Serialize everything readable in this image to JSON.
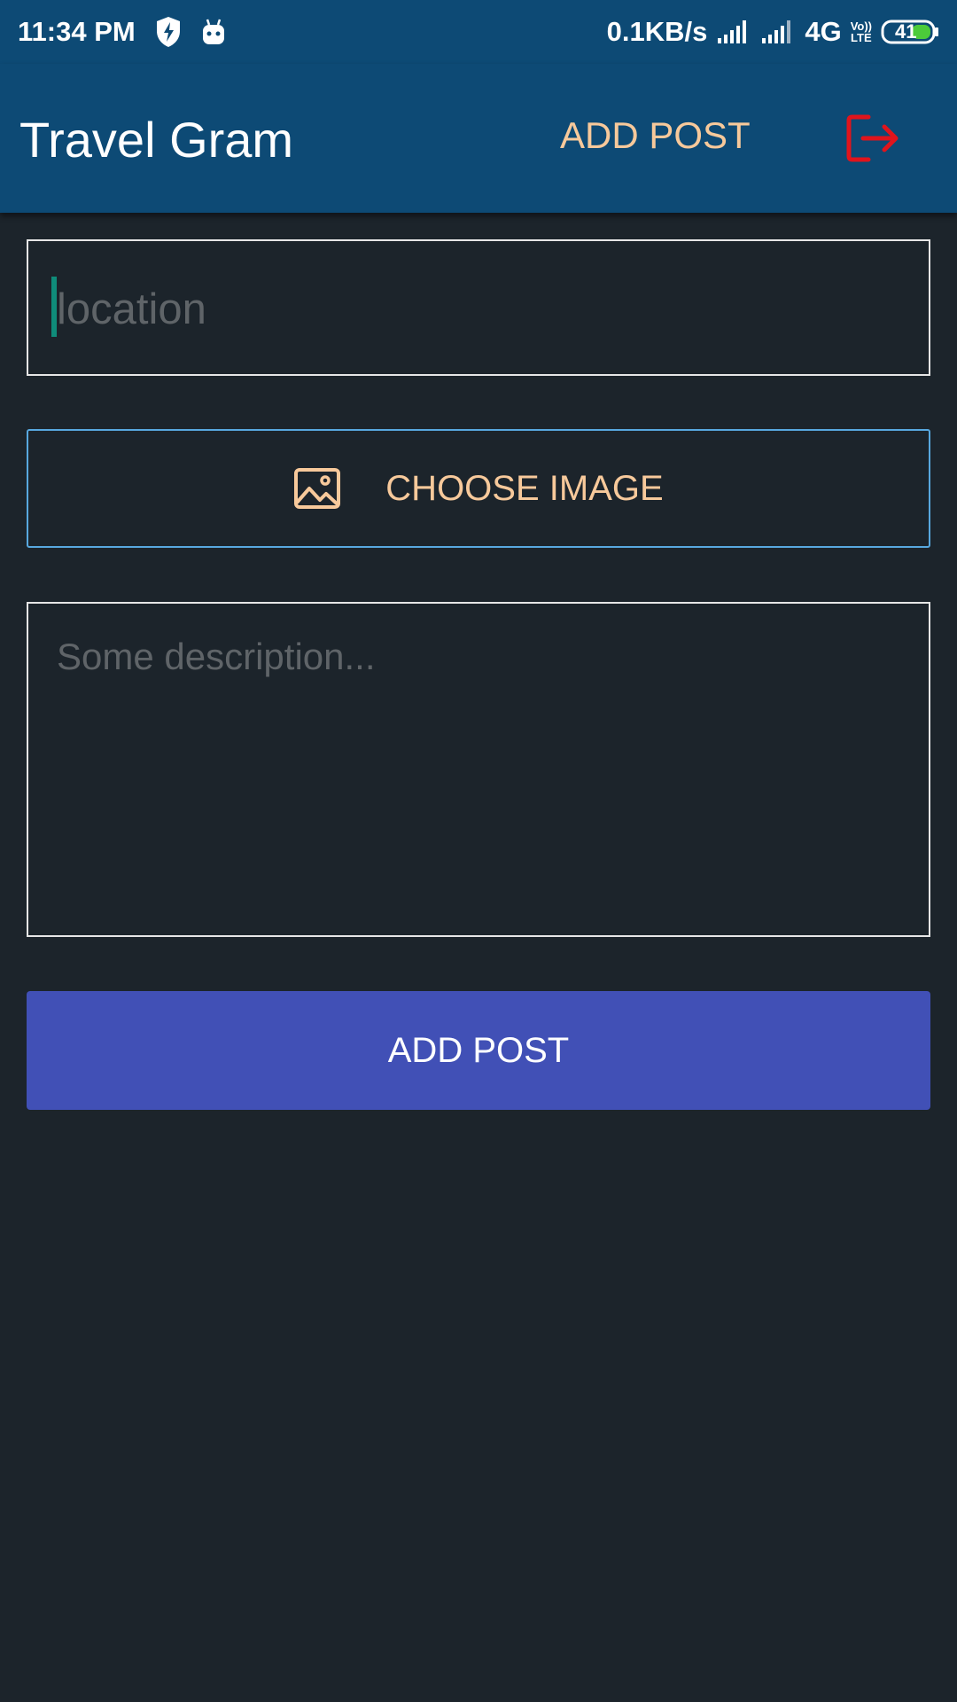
{
  "status_bar": {
    "time": "11:34 PM",
    "network_speed": "0.1KB/s",
    "network_type": "4G",
    "volte_top": "Vo))",
    "volte_bottom": "LTE",
    "battery": "41"
  },
  "app_bar": {
    "title": "Travel Gram",
    "add_post_label": "ADD POST",
    "logout_icon": "logout-icon"
  },
  "form": {
    "location_placeholder": "location",
    "location_value": "",
    "choose_image_label": "CHOOSE IMAGE",
    "choose_image_icon": "image-icon",
    "description_placeholder": "Some description...",
    "description_value": "",
    "submit_label": "ADD POST"
  },
  "colors": {
    "app_bar_bg": "#0d4a75",
    "page_bg": "#1c242b",
    "accent_orange": "#f7c99b",
    "button_blue": "#4150b6",
    "logout_red": "#e0141c",
    "choose_border": "#58a8df"
  }
}
